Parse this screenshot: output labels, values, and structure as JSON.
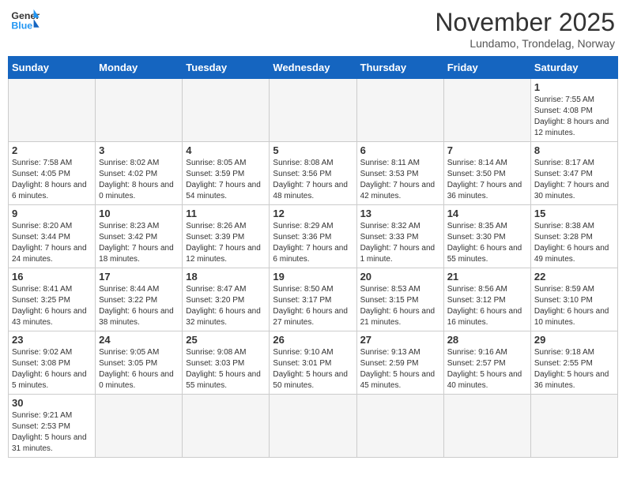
{
  "header": {
    "logo_general": "General",
    "logo_blue": "Blue",
    "month_title": "November 2025",
    "subtitle": "Lundamo, Trondelag, Norway"
  },
  "weekdays": [
    "Sunday",
    "Monday",
    "Tuesday",
    "Wednesday",
    "Thursday",
    "Friday",
    "Saturday"
  ],
  "days": [
    {
      "date": 1,
      "info": "Sunrise: 7:55 AM\nSunset: 4:08 PM\nDaylight: 8 hours and 12 minutes."
    },
    {
      "date": 2,
      "info": "Sunrise: 7:58 AM\nSunset: 4:05 PM\nDaylight: 8 hours and 6 minutes."
    },
    {
      "date": 3,
      "info": "Sunrise: 8:02 AM\nSunset: 4:02 PM\nDaylight: 8 hours and 0 minutes."
    },
    {
      "date": 4,
      "info": "Sunrise: 8:05 AM\nSunset: 3:59 PM\nDaylight: 7 hours and 54 minutes."
    },
    {
      "date": 5,
      "info": "Sunrise: 8:08 AM\nSunset: 3:56 PM\nDaylight: 7 hours and 48 minutes."
    },
    {
      "date": 6,
      "info": "Sunrise: 8:11 AM\nSunset: 3:53 PM\nDaylight: 7 hours and 42 minutes."
    },
    {
      "date": 7,
      "info": "Sunrise: 8:14 AM\nSunset: 3:50 PM\nDaylight: 7 hours and 36 minutes."
    },
    {
      "date": 8,
      "info": "Sunrise: 8:17 AM\nSunset: 3:47 PM\nDaylight: 7 hours and 30 minutes."
    },
    {
      "date": 9,
      "info": "Sunrise: 8:20 AM\nSunset: 3:44 PM\nDaylight: 7 hours and 24 minutes."
    },
    {
      "date": 10,
      "info": "Sunrise: 8:23 AM\nSunset: 3:42 PM\nDaylight: 7 hours and 18 minutes."
    },
    {
      "date": 11,
      "info": "Sunrise: 8:26 AM\nSunset: 3:39 PM\nDaylight: 7 hours and 12 minutes."
    },
    {
      "date": 12,
      "info": "Sunrise: 8:29 AM\nSunset: 3:36 PM\nDaylight: 7 hours and 6 minutes."
    },
    {
      "date": 13,
      "info": "Sunrise: 8:32 AM\nSunset: 3:33 PM\nDaylight: 7 hours and 1 minute."
    },
    {
      "date": 14,
      "info": "Sunrise: 8:35 AM\nSunset: 3:30 PM\nDaylight: 6 hours and 55 minutes."
    },
    {
      "date": 15,
      "info": "Sunrise: 8:38 AM\nSunset: 3:28 PM\nDaylight: 6 hours and 49 minutes."
    },
    {
      "date": 16,
      "info": "Sunrise: 8:41 AM\nSunset: 3:25 PM\nDaylight: 6 hours and 43 minutes."
    },
    {
      "date": 17,
      "info": "Sunrise: 8:44 AM\nSunset: 3:22 PM\nDaylight: 6 hours and 38 minutes."
    },
    {
      "date": 18,
      "info": "Sunrise: 8:47 AM\nSunset: 3:20 PM\nDaylight: 6 hours and 32 minutes."
    },
    {
      "date": 19,
      "info": "Sunrise: 8:50 AM\nSunset: 3:17 PM\nDaylight: 6 hours and 27 minutes."
    },
    {
      "date": 20,
      "info": "Sunrise: 8:53 AM\nSunset: 3:15 PM\nDaylight: 6 hours and 21 minutes."
    },
    {
      "date": 21,
      "info": "Sunrise: 8:56 AM\nSunset: 3:12 PM\nDaylight: 6 hours and 16 minutes."
    },
    {
      "date": 22,
      "info": "Sunrise: 8:59 AM\nSunset: 3:10 PM\nDaylight: 6 hours and 10 minutes."
    },
    {
      "date": 23,
      "info": "Sunrise: 9:02 AM\nSunset: 3:08 PM\nDaylight: 6 hours and 5 minutes."
    },
    {
      "date": 24,
      "info": "Sunrise: 9:05 AM\nSunset: 3:05 PM\nDaylight: 6 hours and 0 minutes."
    },
    {
      "date": 25,
      "info": "Sunrise: 9:08 AM\nSunset: 3:03 PM\nDaylight: 5 hours and 55 minutes."
    },
    {
      "date": 26,
      "info": "Sunrise: 9:10 AM\nSunset: 3:01 PM\nDaylight: 5 hours and 50 minutes."
    },
    {
      "date": 27,
      "info": "Sunrise: 9:13 AM\nSunset: 2:59 PM\nDaylight: 5 hours and 45 minutes."
    },
    {
      "date": 28,
      "info": "Sunrise: 9:16 AM\nSunset: 2:57 PM\nDaylight: 5 hours and 40 minutes."
    },
    {
      "date": 29,
      "info": "Sunrise: 9:18 AM\nSunset: 2:55 PM\nDaylight: 5 hours and 36 minutes."
    },
    {
      "date": 30,
      "info": "Sunrise: 9:21 AM\nSunset: 2:53 PM\nDaylight: 5 hours and 31 minutes."
    }
  ]
}
